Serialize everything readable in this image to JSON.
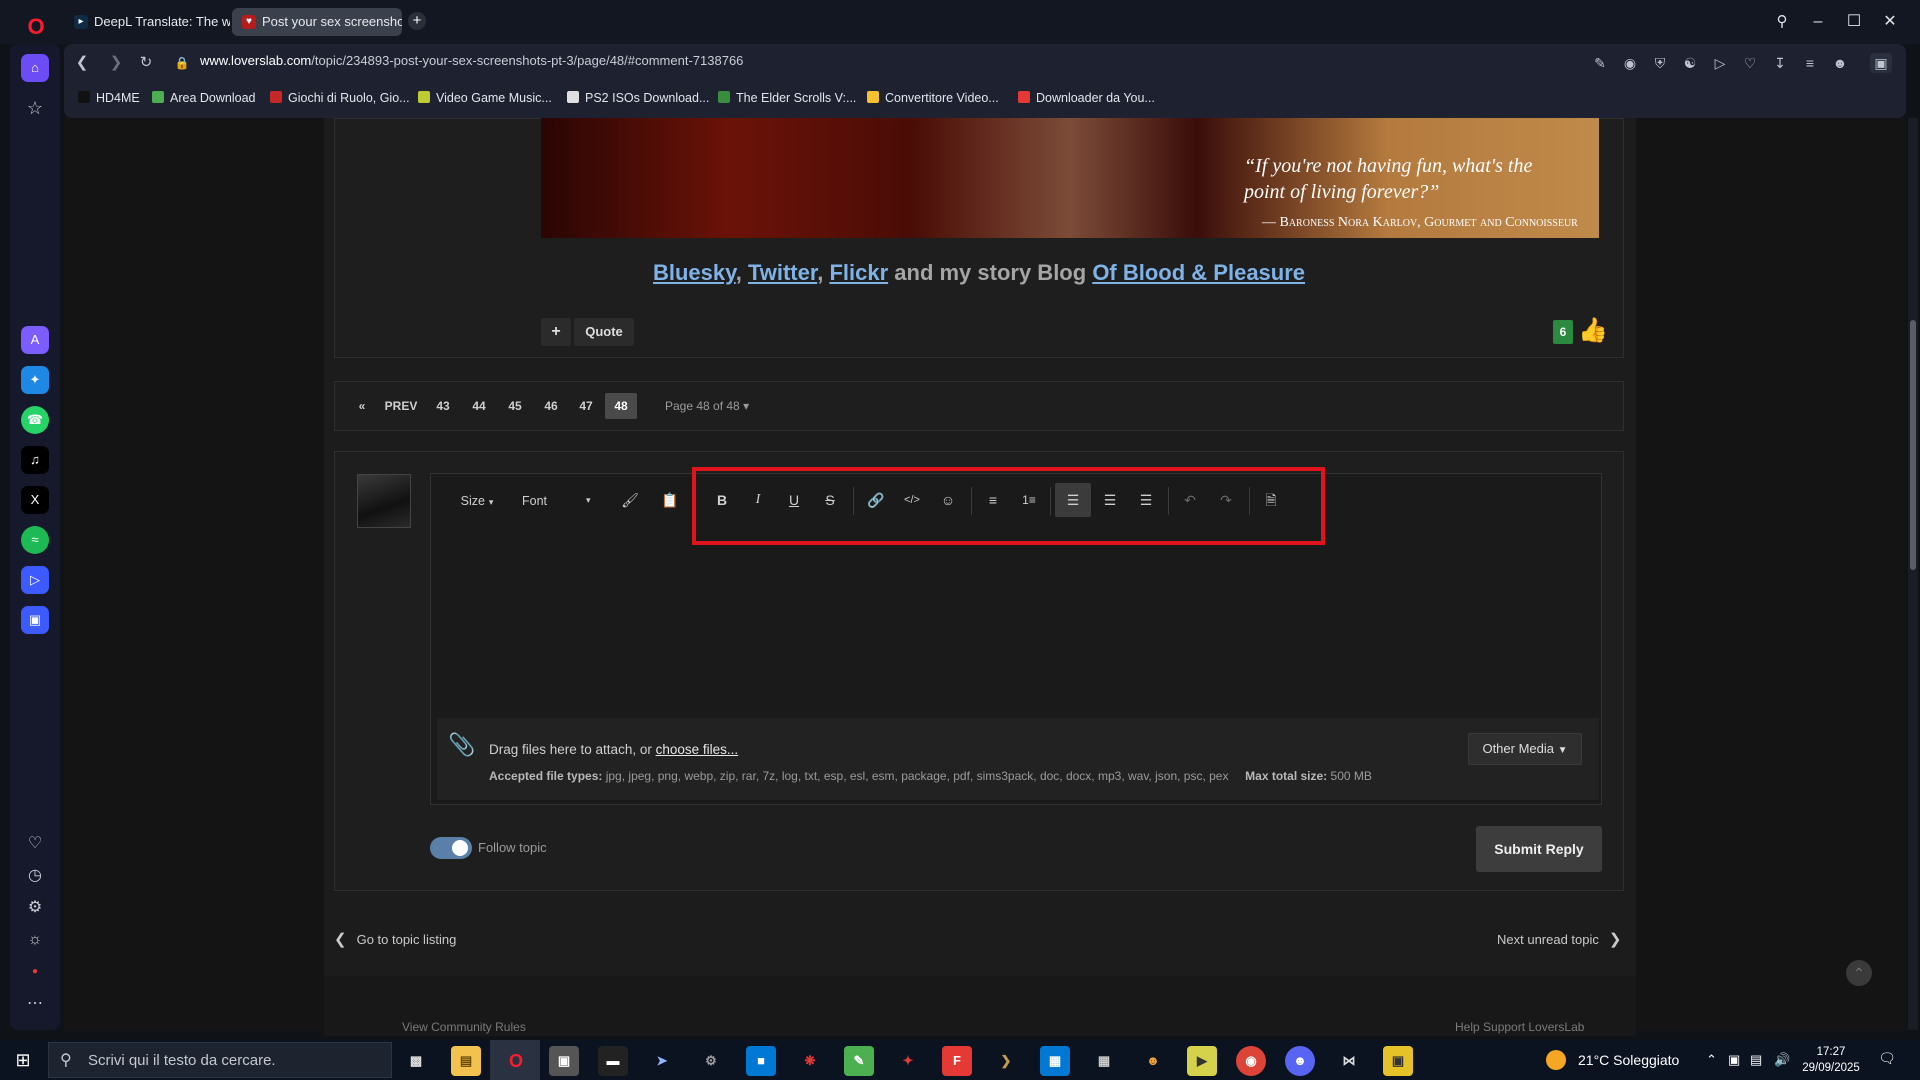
{
  "browser": {
    "tabs": [
      {
        "label": "DeepL Translate: The worl",
        "icon": "deepl-icon"
      },
      {
        "label": "Post your sex screenshots",
        "icon": "loverslab-icon"
      }
    ],
    "new_tab": "+",
    "url_host": "www.loverslab.com",
    "url_path": "/topic/234893-post-your-sex-screenshots-pt-3/page/48/#comment-7138766",
    "bookmarks": [
      {
        "label": "HD4ME",
        "color": "#111111"
      },
      {
        "label": "Area Download",
        "color": "#4caf50"
      },
      {
        "label": "Giochi di Ruolo, Gio...",
        "color": "#c62828"
      },
      {
        "label": "Video Game Music...",
        "color": "#c0ca33"
      },
      {
        "label": "PS2 ISOs Download...",
        "color": "#e0e0e0"
      },
      {
        "label": "The Elder Scrolls V:...",
        "color": "#388e3c"
      },
      {
        "label": "Convertitore Video...",
        "color": "#fbc02d"
      },
      {
        "label": "Downloader da You...",
        "color": "#e53935"
      }
    ]
  },
  "post": {
    "banner_quote_line1": "“If you're not having fun, what's the",
    "banner_quote_line2": "point of living forever?”",
    "banner_attribution": "— Baroness Nora Karlov, Gourmet and Connoisseur",
    "sig_links": [
      "Bluesky",
      "Twitter",
      "Flickr"
    ],
    "sig_text": "and my story Blog",
    "sig_blog": "Of Blood & Pleasure",
    "plus": "+",
    "quote_label": "Quote",
    "reputation": "6"
  },
  "pagination": {
    "prev_label": "PREV",
    "pages": [
      "43",
      "44",
      "45",
      "46",
      "47"
    ],
    "current": "48",
    "page_of": "Page 48 of 48"
  },
  "editor": {
    "size_label": "Size",
    "font_label": "Font",
    "attach_text": "Drag files here to attach, or",
    "choose_files": "choose files...",
    "accepted_label": "Accepted file types:",
    "accepted_types": "jpg, jpeg, png, webp, zip, rar, 7z, log, txt, esp, esl, esm, package, pdf, sims3pack, doc, docx, mp3, wav, json, psc, pex",
    "max_label": "Max total size:",
    "max_value": "500 MB",
    "other_media": "Other Media",
    "follow_label": "Follow topic",
    "submit_label": "Submit Reply"
  },
  "nav": {
    "go_topic": "Go to topic listing",
    "next_unread": "Next unread topic"
  },
  "footer": {
    "left": "View Community Rules",
    "right": "Help Support LoversLab"
  },
  "taskbar": {
    "search_placeholder": "Scrivi qui il testo da cercare.",
    "weather": "21°C  Soleggiato",
    "time": "17:27",
    "date": "29/09/2025"
  }
}
